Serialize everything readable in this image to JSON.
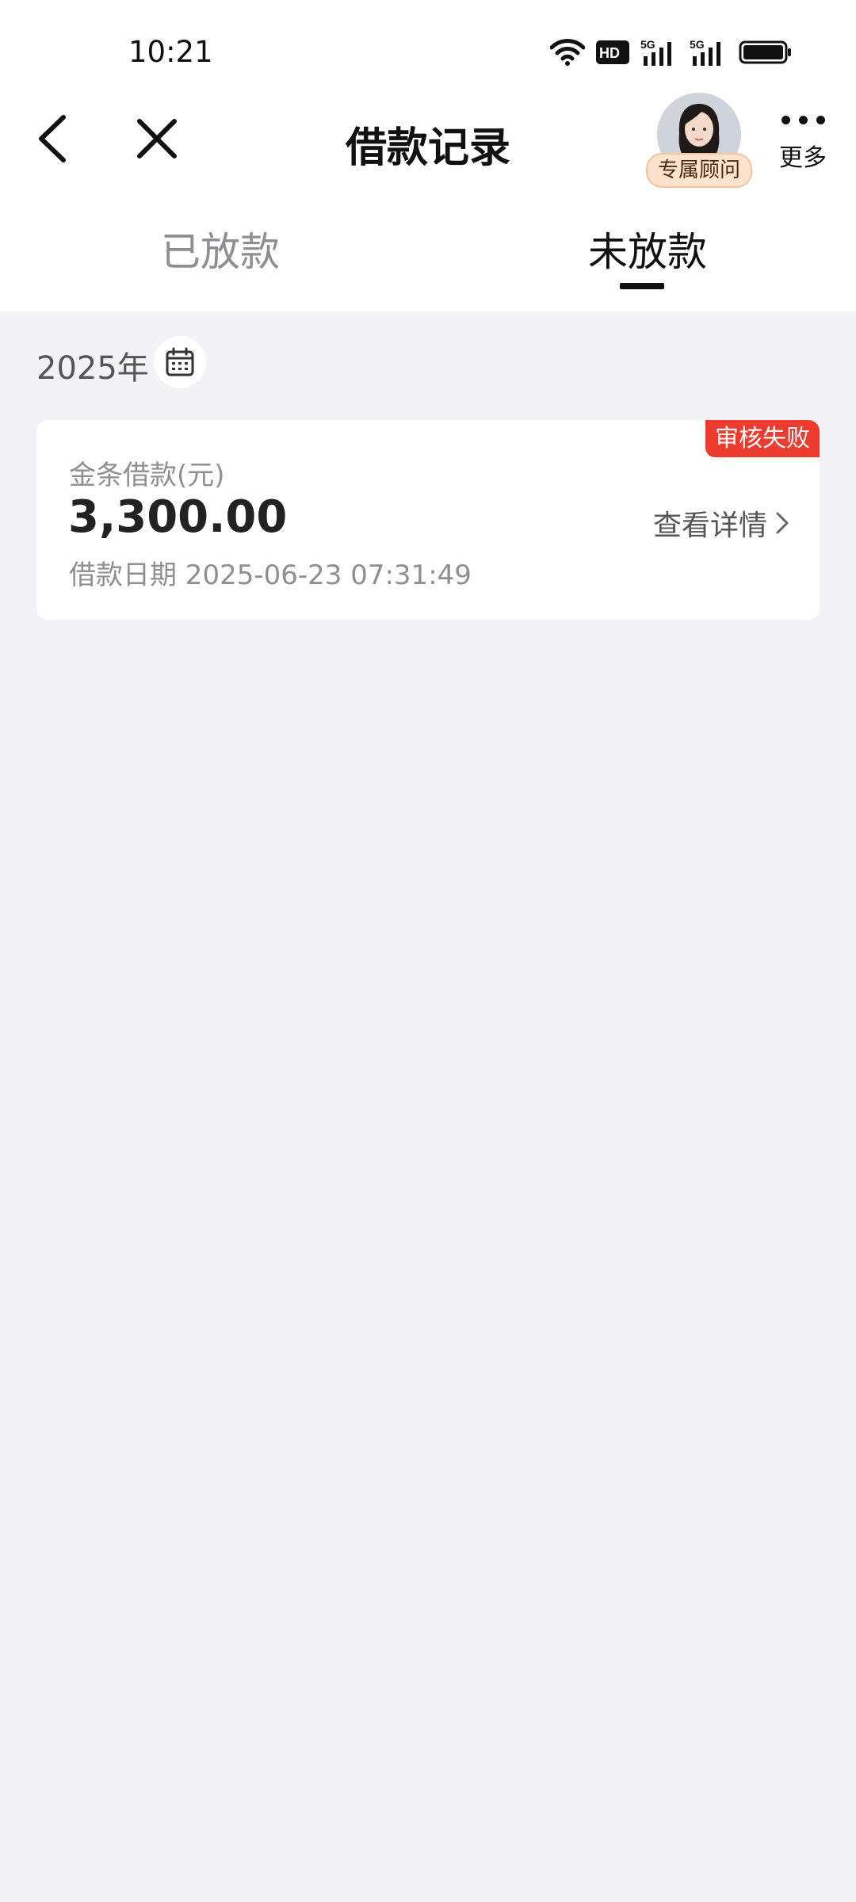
{
  "status_bar": {
    "time": "10:21",
    "icons": [
      "wifi-icon",
      "hd-icon",
      "signal-5g-icon",
      "signal-5g-icon",
      "battery-icon"
    ],
    "hd_text": "HD",
    "network_label": "5G"
  },
  "nav": {
    "back_icon": "chevron-left-icon",
    "close_icon": "close-icon",
    "title": "借款记录",
    "advisor_badge": "专属顾问",
    "more_label": "更多"
  },
  "tabs": [
    {
      "label": "已放款",
      "active": false
    },
    {
      "label": "未放款",
      "active": true
    }
  ],
  "filter": {
    "year": "2025年",
    "calendar_icon": "calendar-icon"
  },
  "loans": [
    {
      "type": "金条借款(元)",
      "amount": "3,300.00",
      "date": "借款日期 2025-06-23 07:31:49",
      "status": "审核失败",
      "detail_label": "查看详情"
    }
  ],
  "colors": {
    "status_failed": "#ee3b2f",
    "background": "#f2f2f7",
    "badge_bg": "#fde3cc"
  }
}
